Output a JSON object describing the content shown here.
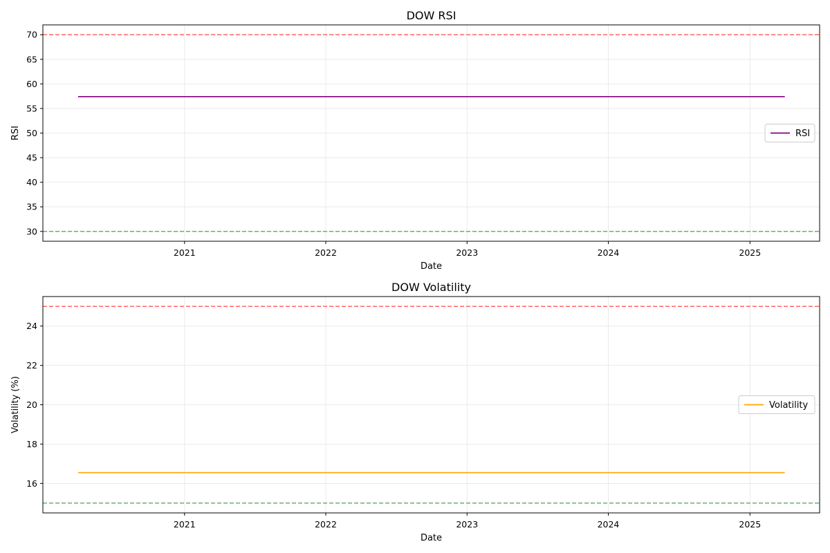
{
  "chart_data": [
    {
      "type": "line",
      "title": "DOW RSI",
      "xlabel": "Date",
      "ylabel": "RSI",
      "xlim": [
        "2020-01-01",
        "2025-06-30"
      ],
      "ylim": [
        28,
        72
      ],
      "x_ticks": [
        "2021",
        "2022",
        "2023",
        "2024",
        "2025"
      ],
      "y_ticks": [
        30,
        35,
        40,
        45,
        50,
        55,
        60,
        65,
        70
      ],
      "grid": true,
      "legend_position": "center-right",
      "series": [
        {
          "name": "RSI",
          "color": "#800080",
          "x": [
            "2020-04-01",
            "2025-04-01"
          ],
          "y": [
            57.4,
            57.4
          ]
        }
      ],
      "reference_lines": [
        {
          "y": 70,
          "color": "#ff6666",
          "style": "dashed"
        },
        {
          "y": 30,
          "color": "#66b366",
          "style": "dashed"
        }
      ]
    },
    {
      "type": "line",
      "title": "DOW Volatility",
      "xlabel": "Date",
      "ylabel": "Volatility (%)",
      "xlim": [
        "2020-01-01",
        "2025-06-30"
      ],
      "ylim": [
        14.5,
        25.5
      ],
      "x_ticks": [
        "2021",
        "2022",
        "2023",
        "2024",
        "2025"
      ],
      "y_ticks": [
        16,
        18,
        20,
        22,
        24
      ],
      "grid": true,
      "legend_position": "center-right",
      "series": [
        {
          "name": "Volatility",
          "color": "#ffa500",
          "x": [
            "2020-04-01",
            "2025-04-01"
          ],
          "y": [
            16.55,
            16.55
          ]
        }
      ],
      "reference_lines": [
        {
          "y": 25,
          "color": "#ff6666",
          "style": "dashed"
        },
        {
          "y": 15,
          "color": "#66b366",
          "style": "dashed"
        }
      ]
    }
  ]
}
